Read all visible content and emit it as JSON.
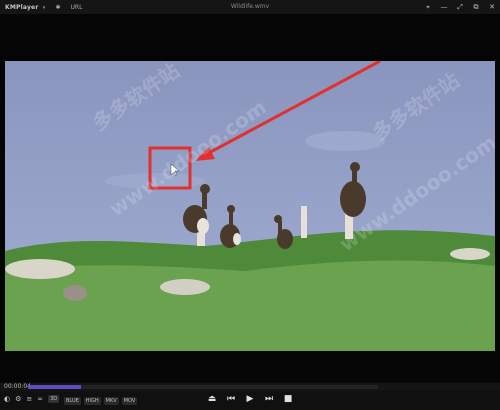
{
  "titlebar": {
    "app_name": "KMPlayer",
    "caret": "▾",
    "settings_icon": "✱",
    "url_label": "URL",
    "title": "Wildlife.wmv",
    "controls": {
      "pin": "⌖",
      "minimize": "—",
      "maximize": "⤢",
      "fullscreen": "⧉",
      "close": "✕"
    }
  },
  "watermarks": {
    "domain": "www.ddooo.com",
    "cn": "多多软件站"
  },
  "annotation": {
    "color": "#e03030"
  },
  "seek": {
    "time": "00:00:04",
    "progress": 0.15
  },
  "controls": {
    "left_icons": [
      "◐",
      "⚙",
      "≡",
      "∞"
    ],
    "badge": "3D",
    "labels": [
      "BLUE",
      "HIGH",
      "MKV",
      "MOV"
    ],
    "center": {
      "eject": "⏏",
      "prev": "⏮",
      "play": "▶",
      "next": "⏭",
      "stop": "■"
    }
  }
}
